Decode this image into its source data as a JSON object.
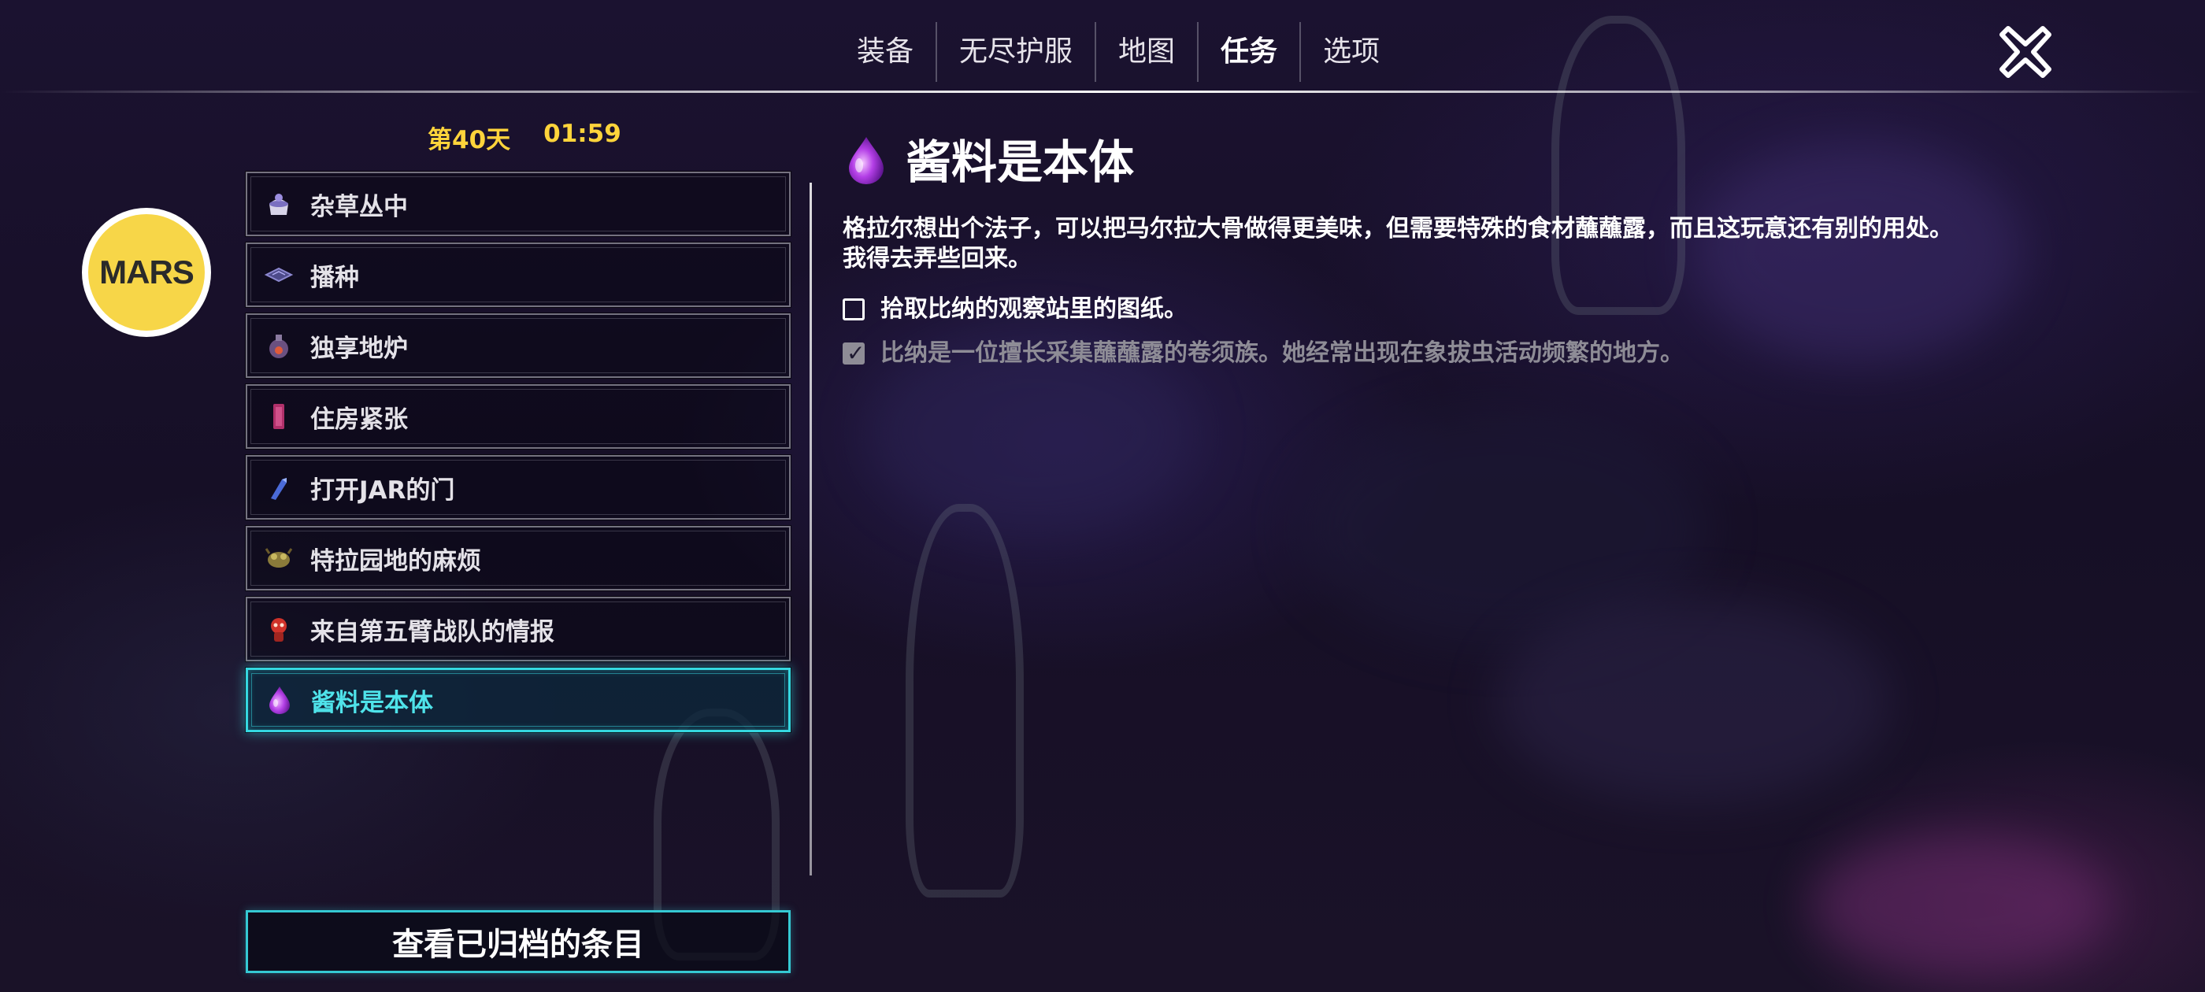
{
  "nav": {
    "tabs": [
      {
        "label": "装备"
      },
      {
        "label": "无尽护服"
      },
      {
        "label": "地图"
      },
      {
        "label": "任务",
        "active": true
      },
      {
        "label": "选项"
      }
    ],
    "close_icon": "close-x-icon"
  },
  "status": {
    "day": "第40天",
    "time": "01:59"
  },
  "profile": {
    "badge": "MARS",
    "badge_color": "#f7d648"
  },
  "quests": [
    {
      "label": "杂草丛中",
      "icon": "pot-plant-icon"
    },
    {
      "label": "播种",
      "icon": "seed-tray-icon"
    },
    {
      "label": "独享地炉",
      "icon": "furnace-icon"
    },
    {
      "label": "住房紧张",
      "icon": "door-panel-icon"
    },
    {
      "label": "打开JAR的门",
      "icon": "key-crystal-icon"
    },
    {
      "label": "特拉园地的麻烦",
      "icon": "creature-icon"
    },
    {
      "label": "来自第五臂战队的情报",
      "icon": "red-alien-icon"
    },
    {
      "label": "酱料是本体",
      "icon": "purple-droplet-icon",
      "active": true
    }
  ],
  "archive_button": "查看已归档的条目",
  "detail": {
    "icon": "purple-droplet-icon",
    "title": "酱料是本体",
    "description": "格拉尔想出个法子，可以把马尔拉大骨做得更美味，但需要特殊的食材蘸蘸露，而且这玩意还有别的用处。我得去弄些回来。",
    "objectives": [
      {
        "text": "拾取比纳的观察站里的图纸。",
        "done": false
      },
      {
        "text": "比纳是一位擅长采集蘸蘸露的卷须族。她经常出现在象拔虫活动频繁的地方。",
        "done": true
      }
    ]
  },
  "colors": {
    "accent": "#35d7e0",
    "highlight_text": "#4fe3ea",
    "day_text": "#ffd43b",
    "completed_text": "#8e8c96"
  }
}
